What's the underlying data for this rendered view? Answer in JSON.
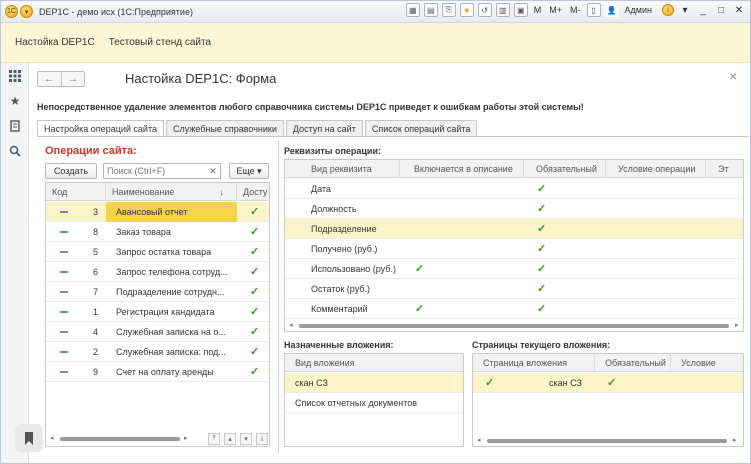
{
  "titlebar": {
    "title": "DEP1C - демо исх  (1С:Предприятие)",
    "tools": [
      "M",
      "M+",
      "M-"
    ],
    "user": "Админ"
  },
  "sections": [
    "Настойка DEP1C",
    "Тестовый стенд сайта"
  ],
  "form": {
    "title": "Настойка DEP1C: Форма",
    "warning": "Непосредственное удаление элементов любого справочника системы DEP1C приведет к ошибкам работы этой системы!"
  },
  "tabs": [
    "Настройка операций сайта",
    "Служебные справочники",
    "Доступ на сайт",
    "Список операций сайта"
  ],
  "operations": {
    "title": "Операции сайта:",
    "create_label": "Создать",
    "search_placeholder": "Поиск (Ctrl+F)",
    "more_label": "Еще",
    "columns": [
      "Код",
      "Наименование",
      "Досту"
    ],
    "rows": [
      {
        "code": "3",
        "name": "Авансовый отчет",
        "selected": true
      },
      {
        "code": "8",
        "name": "Заказ товара",
        "selected": false
      },
      {
        "code": "5",
        "name": "Запрос остатка товара",
        "selected": false
      },
      {
        "code": "6",
        "name": "Запрос телефона сотруд...",
        "selected": false
      },
      {
        "code": "7",
        "name": "Подразделение сотрудн...",
        "selected": false
      },
      {
        "code": "1",
        "name": "Регистрация кандидата",
        "selected": false
      },
      {
        "code": "4",
        "name": "Служебная записка на о...",
        "selected": false
      },
      {
        "code": "2",
        "name": "Служебная записка: под...",
        "selected": false
      },
      {
        "code": "9",
        "name": "Счет на оплату аренды",
        "selected": false
      }
    ]
  },
  "requisites": {
    "title": "Реквизиты операции:",
    "columns": [
      "Вид реквизита",
      "Включается в описание",
      "Обязательный",
      "Условие операции",
      "Эт"
    ],
    "rows": [
      {
        "name": "Дата",
        "in_desc": false,
        "required": true,
        "selected": false
      },
      {
        "name": "Должность",
        "in_desc": false,
        "required": true,
        "selected": false
      },
      {
        "name": "Подразделение",
        "in_desc": false,
        "required": true,
        "selected": true
      },
      {
        "name": "Получено (руб.)",
        "in_desc": false,
        "required": true,
        "selected": false
      },
      {
        "name": "Использовано (руб.)",
        "in_desc": true,
        "required": true,
        "selected": false
      },
      {
        "name": "Остаток (руб.)",
        "in_desc": false,
        "required": true,
        "selected": false
      },
      {
        "name": "Комментарий",
        "in_desc": true,
        "required": true,
        "selected": false
      }
    ]
  },
  "attachments": {
    "title": "Назначенные вложения:",
    "column": "Вид вложения",
    "rows": [
      {
        "name": "скан СЗ",
        "selected": true
      },
      {
        "name": "Список отчетных документов",
        "selected": false
      }
    ]
  },
  "pages": {
    "title": "Страницы текущего вложения:",
    "columns": [
      "Страница вложения",
      "Обязательный",
      "Условие"
    ],
    "rows": [
      {
        "page": "скан СЗ",
        "required": true,
        "selected": true
      }
    ]
  },
  "colors": {
    "accent": "#c0392b",
    "selection": "#fbf4c8",
    "highlight": "#f5d34a",
    "check": "#3a9a2a",
    "section_bar": "#fbf7d6"
  },
  "icons": [
    "apps-grid-icon",
    "star-icon",
    "history-icon",
    "search-icon",
    "bookmark-icon"
  ]
}
